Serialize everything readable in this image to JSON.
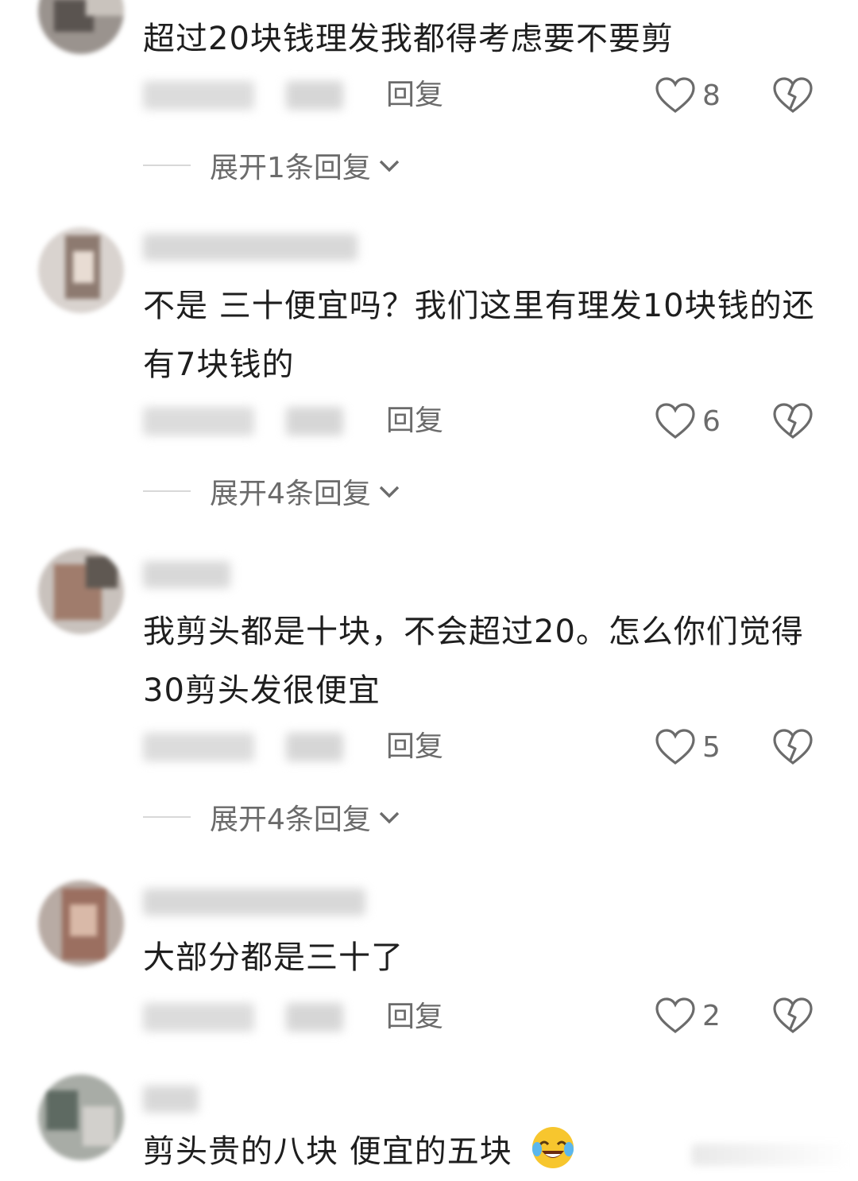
{
  "colors": {
    "text": "#1e1e1e",
    "secondary": "#6b6b6b",
    "divider": "#d8d8d8"
  },
  "comments": [
    {
      "text": "超过20块钱理发我都得考虑要不要剪",
      "reply_label": "回复",
      "likes": "8",
      "expand_label": "展开1条回复"
    },
    {
      "text": "不是 三十便宜吗？我们这里有理发10块钱的还有7块钱的",
      "reply_label": "回复",
      "likes": "6",
      "expand_label": "展开4条回复"
    },
    {
      "text": "我剪头都是十块，不会超过20。怎么你们觉得30剪头发很便宜",
      "reply_label": "回复",
      "likes": "5",
      "expand_label": "展开4条回复"
    },
    {
      "text": "大部分都是三十了",
      "reply_label": "回复",
      "likes": "2"
    },
    {
      "text": "剪头贵的八块 便宜的五块",
      "emoji": "crying-laughing-emoji"
    }
  ]
}
